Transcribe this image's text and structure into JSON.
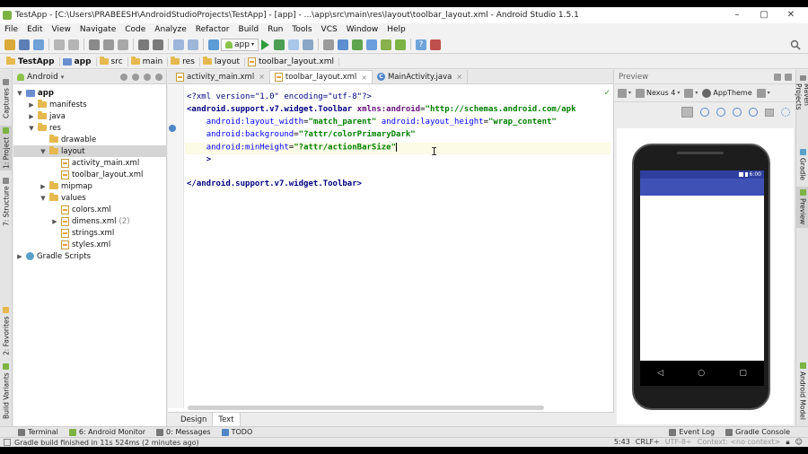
{
  "window": {
    "title": "TestApp - [C:\\Users\\PRABEESH\\AndroidStudioProjects\\TestApp] - [app] - ...\\app\\src\\main\\res\\layout\\toolbar_layout.xml - Android Studio 1.5.1",
    "controls": {
      "minimize": "–",
      "maximize": "▢",
      "close": "✕"
    }
  },
  "menu": [
    "File",
    "Edit",
    "View",
    "Navigate",
    "Code",
    "Analyze",
    "Refactor",
    "Build",
    "Run",
    "Tools",
    "VCS",
    "Window",
    "Help"
  ],
  "toolbar": {
    "run_config": "app"
  },
  "breadcrumb": [
    "TestApp",
    "app",
    "src",
    "main",
    "res",
    "layout",
    "toolbar_layout.xml"
  ],
  "left_tool_windows": [
    "Captures",
    "1: Project",
    "7: Structure",
    "2: Favorites",
    "Build Variants"
  ],
  "right_tool_windows": [
    "Maven Projects",
    "Gradle",
    "Preview",
    "Android Model"
  ],
  "project": {
    "view_mode": "Android",
    "tree": [
      {
        "label": "app",
        "level": 0,
        "kind": "module",
        "expanded": true
      },
      {
        "label": "manifests",
        "level": 1,
        "kind": "folder",
        "expanded": false
      },
      {
        "label": "java",
        "level": 1,
        "kind": "folder",
        "expanded": false
      },
      {
        "label": "res",
        "level": 1,
        "kind": "folder",
        "expanded": true
      },
      {
        "label": "drawable",
        "level": 2,
        "kind": "folder",
        "expanded": null
      },
      {
        "label": "layout",
        "level": 2,
        "kind": "folder",
        "expanded": true,
        "selected": true
      },
      {
        "label": "activity_main.xml",
        "level": 3,
        "kind": "xml"
      },
      {
        "label": "toolbar_layout.xml",
        "level": 3,
        "kind": "xml"
      },
      {
        "label": "mipmap",
        "level": 2,
        "kind": "folder",
        "expanded": false
      },
      {
        "label": "values",
        "level": 2,
        "kind": "folder",
        "expanded": true
      },
      {
        "label": "colors.xml",
        "level": 3,
        "kind": "xml"
      },
      {
        "label": "dimens.xml",
        "level": 3,
        "kind": "xml",
        "count": "(2)",
        "expanded": false
      },
      {
        "label": "strings.xml",
        "level": 3,
        "kind": "xml"
      },
      {
        "label": "styles.xml",
        "level": 3,
        "kind": "xml"
      },
      {
        "label": "Gradle Scripts",
        "level": 0,
        "kind": "gradle",
        "expanded": false
      }
    ]
  },
  "editor": {
    "tabs": [
      {
        "label": "activity_main.xml",
        "kind": "xml",
        "active": false
      },
      {
        "label": "toolbar_layout.xml",
        "kind": "xml",
        "active": true
      },
      {
        "label": "MainActivity.java",
        "kind": "class",
        "active": false
      }
    ],
    "code": {
      "l1": "<?xml version=\"1.0\" encoding=\"utf-8\"?>",
      "l2_tag": "<android.support.v7.widget.Toolbar ",
      "l2_ns": "xmlns:android",
      "l2_eq": "=",
      "l2_val": "\"http://schemas.android.com/apk",
      "l3_a1": "android:layout_width",
      "l3_v1": "\"match_parent\"",
      "l3_a2": "android:layout_height",
      "l3_v2": "\"wrap_content\"",
      "l4_a": "android:background",
      "l4_v": "\"?attr/colorPrimaryDark\"",
      "l5_a": "android:minHeight",
      "l5_v": "\"?attr/actionBarSize\"",
      "l6": ">",
      "l8": "</android.support.v7.widget.Toolbar>"
    },
    "bottom_tabs": [
      "Design",
      "Text"
    ],
    "active_bottom_tab": "Text"
  },
  "preview": {
    "title": "Preview",
    "device": "Nexus 4",
    "theme": "AppTheme",
    "status_time": "6:00",
    "nav": {
      "back": "◁",
      "home": "○",
      "recents": "▢"
    },
    "colors": {
      "toolbar": "#3f51b5",
      "status_bar": "#2f3f9f"
    }
  },
  "bottom_tools": {
    "left": [
      "Terminal",
      "6: Android Monitor",
      "0: Messages",
      "TODO"
    ],
    "right": [
      "Event Log",
      "Gradle Console"
    ]
  },
  "status": {
    "message": "Gradle build finished in 11s 524ms (2 minutes ago)",
    "position": "5:43",
    "line_sep": "CRLF÷",
    "encoding": "UTF-8÷",
    "context": "Context: <no context>"
  }
}
